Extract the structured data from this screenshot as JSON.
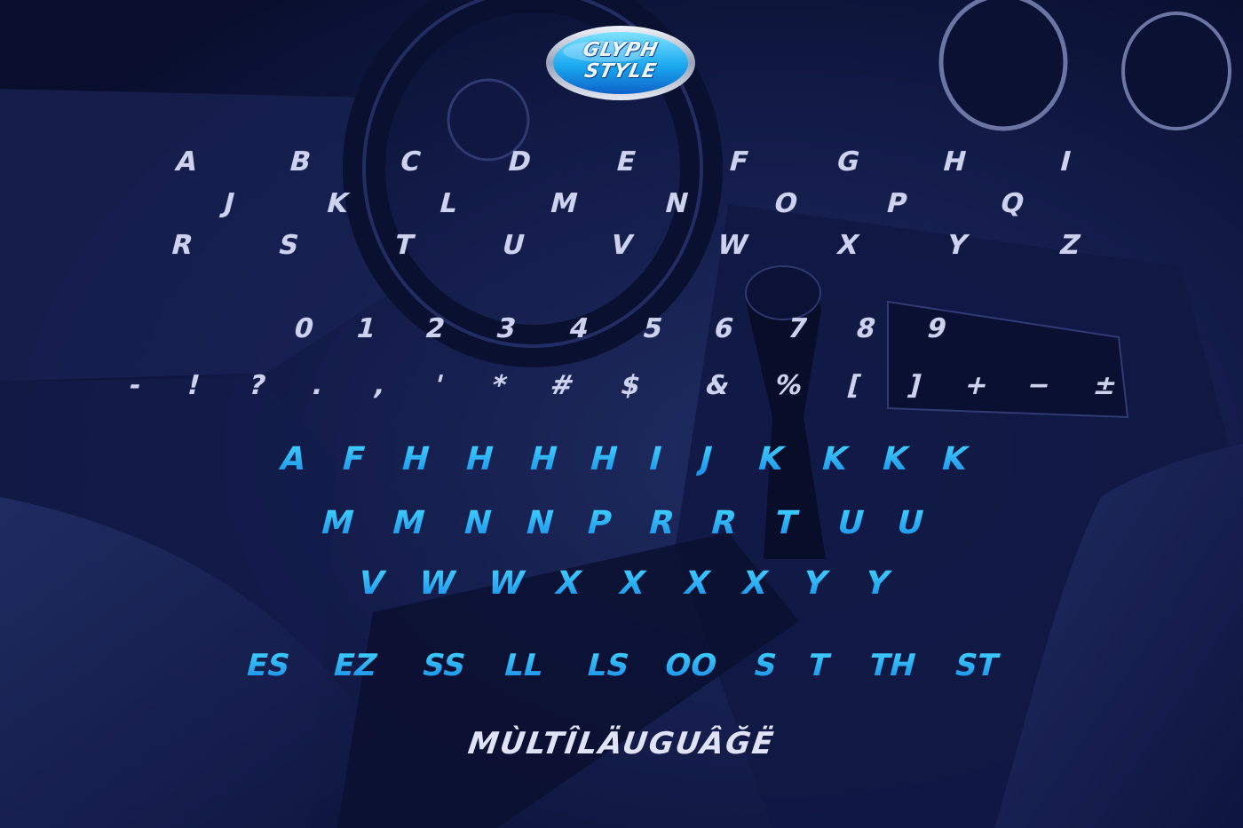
{
  "badge": {
    "line1": "GLYPH",
    "line2": "STYLE"
  },
  "uppercase_rows": [
    [
      "A",
      "B",
      "C",
      "D",
      "E",
      "F",
      "G",
      "H",
      "I"
    ],
    [
      "J",
      "K",
      "L",
      "M",
      "N",
      "O",
      "P",
      "Q"
    ],
    [
      "R",
      "S",
      "T",
      "U",
      "V",
      "W",
      "X",
      "Y",
      "Z"
    ]
  ],
  "digits": [
    "0",
    "1",
    "2",
    "3",
    "4",
    "5",
    "6",
    "7",
    "8",
    "9"
  ],
  "symbols": [
    "-",
    "!",
    "?",
    ".",
    ",",
    "'",
    "*",
    "#",
    "$",
    "&",
    "%",
    "[",
    "]",
    "+",
    "−",
    "±"
  ],
  "alternate_rows": [
    [
      "A",
      "F",
      "H",
      "H",
      "H",
      "H",
      "I",
      "J",
      "K",
      "K",
      "K",
      "K"
    ],
    [
      "M",
      "M",
      "N",
      "N",
      "P",
      "R",
      "R",
      "T",
      "U",
      "U"
    ],
    [
      "V",
      "W",
      "W",
      "X",
      "X",
      "X",
      "X",
      "Y",
      "Y"
    ]
  ],
  "ligatures": [
    "ES",
    "EZ",
    "SS",
    "LL",
    "LS",
    "OO",
    "S",
    "T",
    "TH",
    "ST"
  ],
  "multilanguage": "MÙLTÎLÄUGUÂĞË",
  "colors": {
    "white_glyph": "#cdd3ee",
    "cyan_glyph": "#27b6f4",
    "background": "#0b1236"
  }
}
